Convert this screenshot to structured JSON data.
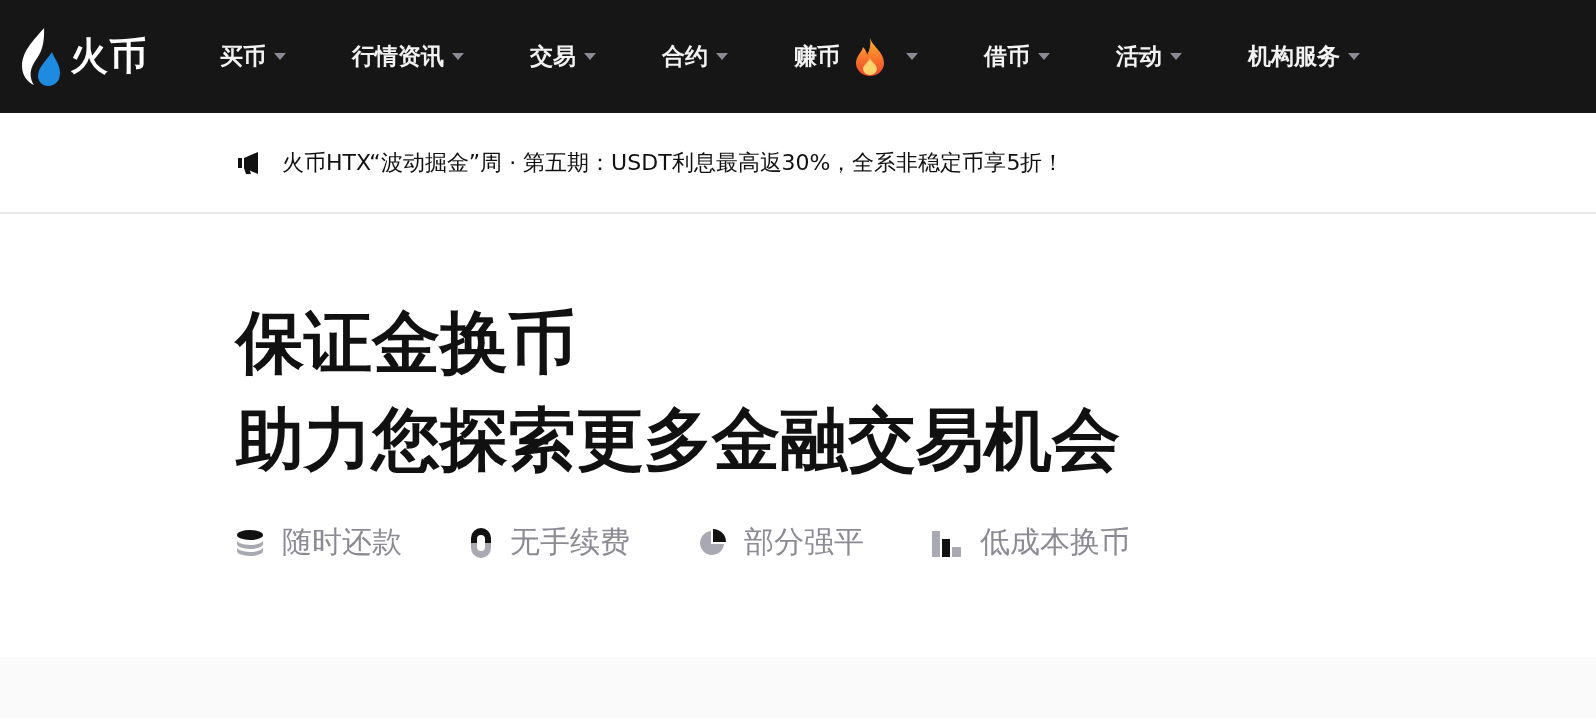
{
  "logo": {
    "text": "火币"
  },
  "nav": [
    {
      "label": "买币",
      "hot": false
    },
    {
      "label": "行情资讯",
      "hot": false
    },
    {
      "label": "交易",
      "hot": false
    },
    {
      "label": "合约",
      "hot": false
    },
    {
      "label": "赚币",
      "hot": true
    },
    {
      "label": "借币",
      "hot": false
    },
    {
      "label": "活动",
      "hot": false
    },
    {
      "label": "机构服务",
      "hot": false
    }
  ],
  "announcement": "火币HTX“波动掘金”周 · 第五期：USDT利息最高返30%，全系非稳定币享5折！",
  "hero": {
    "title_lines": [
      "保证金换币",
      "助力您探索更多金融交易机会"
    ],
    "features": [
      {
        "kind": "coins",
        "label": "随时还款"
      },
      {
        "kind": "ring",
        "label": "无手续费"
      },
      {
        "kind": "pie",
        "label": "部分强平"
      },
      {
        "kind": "bars",
        "label": "低成本换币"
      }
    ]
  }
}
